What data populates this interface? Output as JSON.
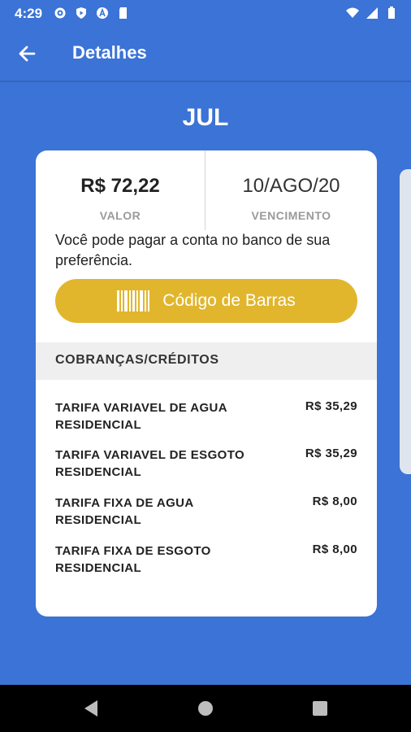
{
  "status": {
    "time": "4:29"
  },
  "header": {
    "title": "Detalhes"
  },
  "month": "JUL",
  "bill": {
    "amount": "R$ 72,22",
    "amount_label": "VALOR",
    "due_date": "10/AGO/20",
    "due_label": "VENCIMENTO",
    "info": "Você pode pagar a conta no banco de sua preferência.",
    "barcode_button": "Código de Barras"
  },
  "charges": {
    "title": "COBRANÇAS/CRÉDITOS",
    "items": [
      {
        "name": "TARIFA VARIAVEL DE AGUA RESIDENCIAL",
        "value": "R$ 35,29"
      },
      {
        "name": "TARIFA VARIAVEL DE ESGOTO RESIDENCIAL",
        "value": "R$ 35,29"
      },
      {
        "name": "TARIFA FIXA DE AGUA RESIDENCIAL",
        "value": "R$ 8,00"
      },
      {
        "name": "TARIFA FIXA DE ESGOTO RESIDENCIAL",
        "value": "R$ 8,00"
      }
    ]
  },
  "colors": {
    "primary": "#3b73d6",
    "accent": "#e1b62d",
    "nav": "#000000"
  }
}
